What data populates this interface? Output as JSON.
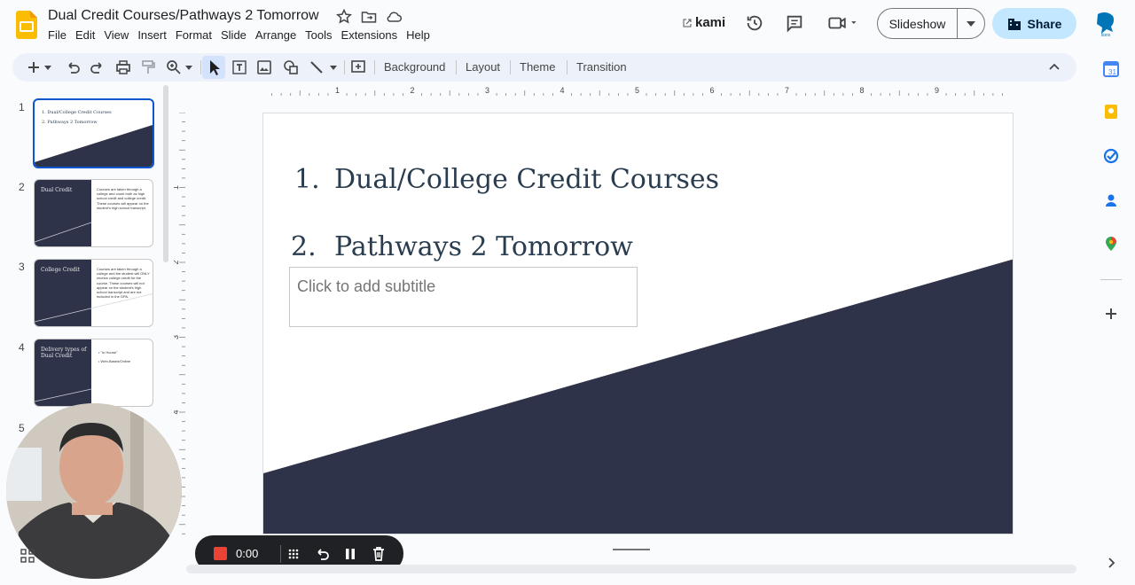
{
  "app": {
    "title": "Dual Credit Courses/Pathways 2 Tomorrow",
    "menu": [
      "File",
      "Edit",
      "View",
      "Insert",
      "Format",
      "Slide",
      "Arrange",
      "Tools",
      "Extensions",
      "Help"
    ],
    "kami_label": "kami",
    "slideshow_label": "Slideshow",
    "share_label": "Share",
    "brand_color": "#fbbc04",
    "share_color": "#c2e7ff"
  },
  "toolbar": {
    "background_label": "Background",
    "layout_label": "Layout",
    "theme_label": "Theme",
    "transition_label": "Transition"
  },
  "filmstrip": {
    "slides": [
      {
        "num": "1",
        "line1": "1. Dual/College Credit Courses",
        "line2": "2. Pathways 2 Tomorrow"
      },
      {
        "num": "2",
        "title": "Dual Credit",
        "body": "Courses are taken through a college and count both as high school credit and college credit. These courses will appear on the student's high school transcript."
      },
      {
        "num": "3",
        "title": "College Credit",
        "body": "Courses are taken through a college and the student will ONLY receive college credit for the course. These courses will not appear on the student's high school transcript and are not included in the GPA."
      },
      {
        "num": "4",
        "title": "Delivery types of Dual Credit",
        "bullets": [
          "\"In House\"",
          "Web-Based/Online"
        ]
      },
      {
        "num": "5"
      }
    ]
  },
  "slide": {
    "line1_num": "1.",
    "line1_text": "Dual/College Credit Courses",
    "line2_num": "2.",
    "line2_text": "Pathways 2 Tomorrow",
    "subtitle_placeholder": "Click to add subtitle",
    "title_color": "#2a3c4f",
    "wedge_color": "#2f3349"
  },
  "ruler": {
    "h_labels": [
      "1",
      "2",
      "3",
      "4",
      "5",
      "6",
      "7",
      "8",
      "9"
    ],
    "v_labels": [
      "1",
      "2",
      "3",
      "4"
    ]
  },
  "recorder": {
    "time": "0:00"
  }
}
